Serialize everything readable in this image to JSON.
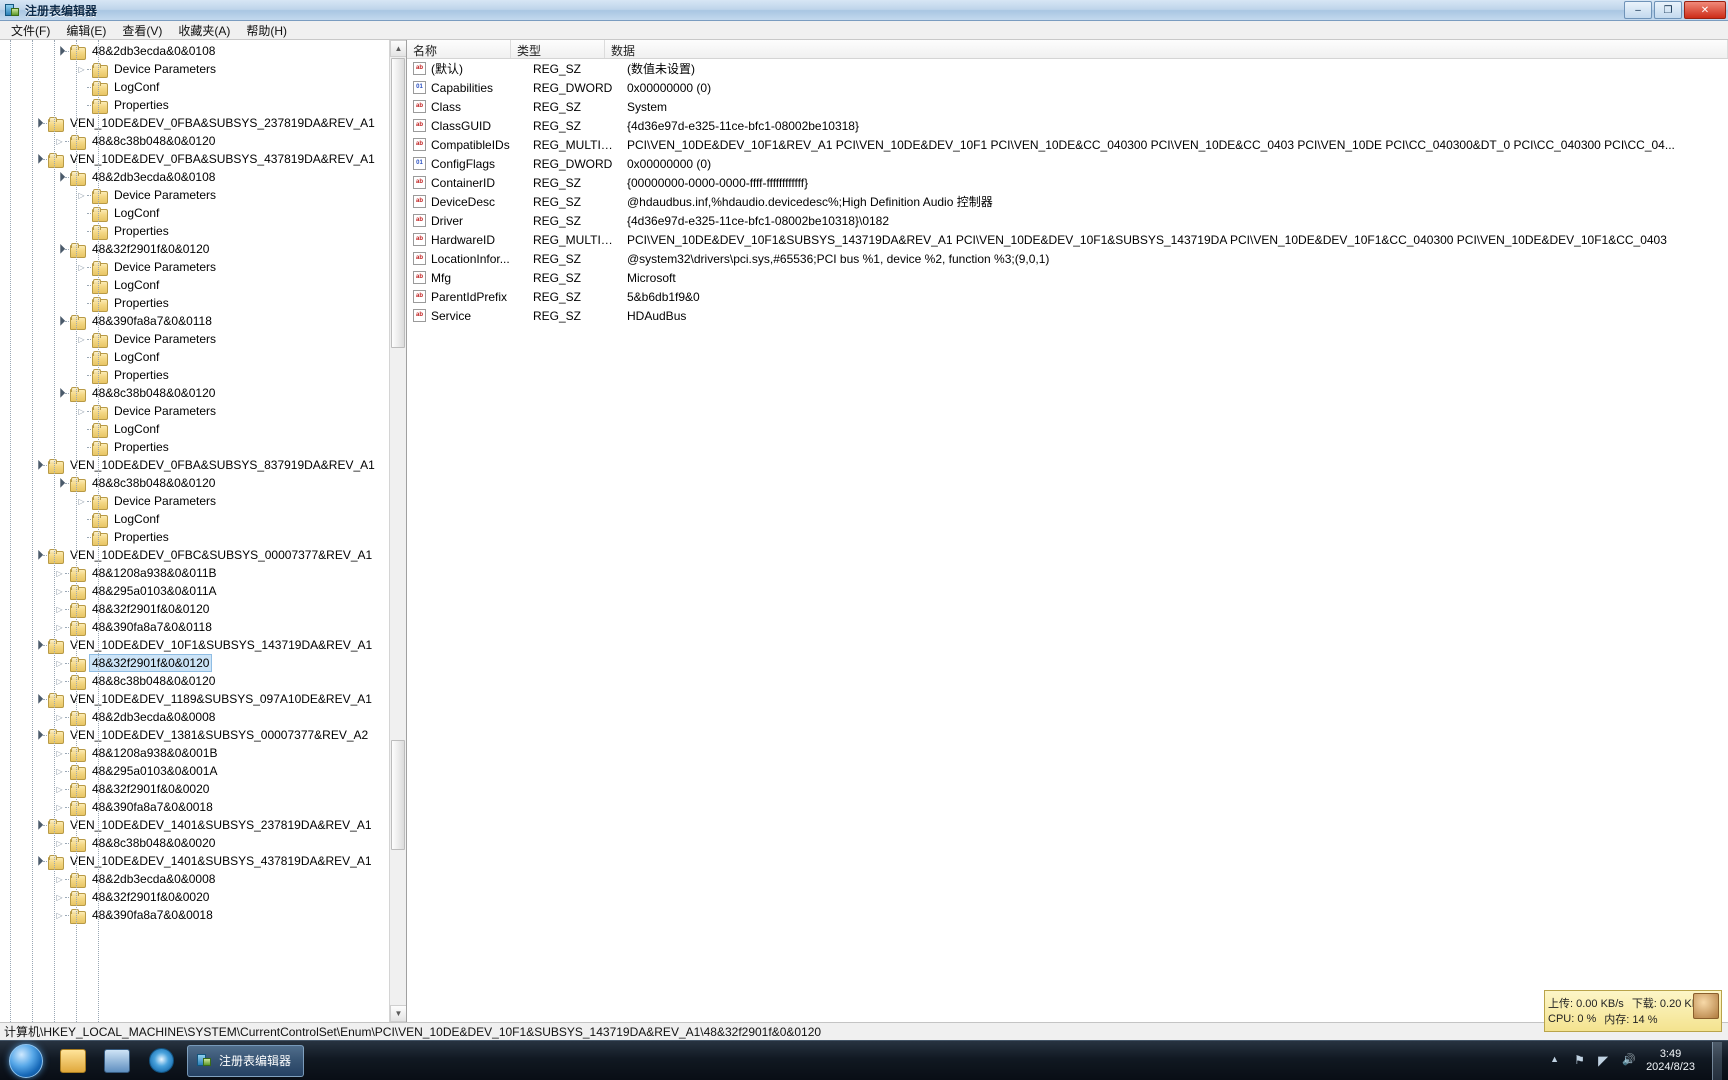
{
  "window": {
    "title": "注册表编辑器",
    "icon": "registry-icon",
    "buttons": {
      "minimize": "–",
      "maximize": "❐",
      "close": "✕"
    }
  },
  "menu": [
    {
      "label": "文件(F)"
    },
    {
      "label": "编辑(E)"
    },
    {
      "label": "查看(V)"
    },
    {
      "label": "收藏夹(A)"
    },
    {
      "label": "帮助(H)"
    }
  ],
  "tree": [
    {
      "label": "48&2db3ecda&0&0108",
      "depth": 3,
      "state": "open"
    },
    {
      "label": "Device Parameters",
      "depth": 4,
      "state": "closed"
    },
    {
      "label": "LogConf",
      "depth": 4,
      "state": "leaf"
    },
    {
      "label": "Properties",
      "depth": 4,
      "state": "leaf"
    },
    {
      "label": "VEN_10DE&DEV_0FBA&SUBSYS_237819DA&REV_A1",
      "depth": 2,
      "state": "open"
    },
    {
      "label": "48&8c38b048&0&0120",
      "depth": 3,
      "state": "closed"
    },
    {
      "label": "VEN_10DE&DEV_0FBA&SUBSYS_437819DA&REV_A1",
      "depth": 2,
      "state": "open"
    },
    {
      "label": "48&2db3ecda&0&0108",
      "depth": 3,
      "state": "open"
    },
    {
      "label": "Device Parameters",
      "depth": 4,
      "state": "closed"
    },
    {
      "label": "LogConf",
      "depth": 4,
      "state": "leaf"
    },
    {
      "label": "Properties",
      "depth": 4,
      "state": "leaf"
    },
    {
      "label": "48&32f2901f&0&0120",
      "depth": 3,
      "state": "open"
    },
    {
      "label": "Device Parameters",
      "depth": 4,
      "state": "closed"
    },
    {
      "label": "LogConf",
      "depth": 4,
      "state": "leaf"
    },
    {
      "label": "Properties",
      "depth": 4,
      "state": "leaf"
    },
    {
      "label": "48&390fa8a7&0&0118",
      "depth": 3,
      "state": "open"
    },
    {
      "label": "Device Parameters",
      "depth": 4,
      "state": "closed"
    },
    {
      "label": "LogConf",
      "depth": 4,
      "state": "leaf"
    },
    {
      "label": "Properties",
      "depth": 4,
      "state": "leaf"
    },
    {
      "label": "48&8c38b048&0&0120",
      "depth": 3,
      "state": "open"
    },
    {
      "label": "Device Parameters",
      "depth": 4,
      "state": "closed"
    },
    {
      "label": "LogConf",
      "depth": 4,
      "state": "leaf"
    },
    {
      "label": "Properties",
      "depth": 4,
      "state": "leaf"
    },
    {
      "label": "VEN_10DE&DEV_0FBA&SUBSYS_837919DA&REV_A1",
      "depth": 2,
      "state": "open"
    },
    {
      "label": "48&8c38b048&0&0120",
      "depth": 3,
      "state": "open"
    },
    {
      "label": "Device Parameters",
      "depth": 4,
      "state": "closed"
    },
    {
      "label": "LogConf",
      "depth": 4,
      "state": "leaf"
    },
    {
      "label": "Properties",
      "depth": 4,
      "state": "leaf"
    },
    {
      "label": "VEN_10DE&DEV_0FBC&SUBSYS_00007377&REV_A1",
      "depth": 2,
      "state": "open"
    },
    {
      "label": "48&1208a938&0&011B",
      "depth": 3,
      "state": "closed"
    },
    {
      "label": "48&295a0103&0&011A",
      "depth": 3,
      "state": "closed"
    },
    {
      "label": "48&32f2901f&0&0120",
      "depth": 3,
      "state": "closed"
    },
    {
      "label": "48&390fa8a7&0&0118",
      "depth": 3,
      "state": "closed"
    },
    {
      "label": "VEN_10DE&DEV_10F1&SUBSYS_143719DA&REV_A1",
      "depth": 2,
      "state": "open"
    },
    {
      "label": "48&32f2901f&0&0120",
      "depth": 3,
      "state": "closed",
      "selected": true
    },
    {
      "label": "48&8c38b048&0&0120",
      "depth": 3,
      "state": "closed"
    },
    {
      "label": "VEN_10DE&DEV_1189&SUBSYS_097A10DE&REV_A1",
      "depth": 2,
      "state": "open"
    },
    {
      "label": "48&2db3ecda&0&0008",
      "depth": 3,
      "state": "closed"
    },
    {
      "label": "VEN_10DE&DEV_1381&SUBSYS_00007377&REV_A2",
      "depth": 2,
      "state": "open"
    },
    {
      "label": "48&1208a938&0&001B",
      "depth": 3,
      "state": "closed"
    },
    {
      "label": "48&295a0103&0&001A",
      "depth": 3,
      "state": "closed"
    },
    {
      "label": "48&32f2901f&0&0020",
      "depth": 3,
      "state": "closed"
    },
    {
      "label": "48&390fa8a7&0&0018",
      "depth": 3,
      "state": "closed"
    },
    {
      "label": "VEN_10DE&DEV_1401&SUBSYS_237819DA&REV_A1",
      "depth": 2,
      "state": "open"
    },
    {
      "label": "48&8c38b048&0&0020",
      "depth": 3,
      "state": "closed"
    },
    {
      "label": "VEN_10DE&DEV_1401&SUBSYS_437819DA&REV_A1",
      "depth": 2,
      "state": "open"
    },
    {
      "label": "48&2db3ecda&0&0008",
      "depth": 3,
      "state": "closed"
    },
    {
      "label": "48&32f2901f&0&0020",
      "depth": 3,
      "state": "closed"
    },
    {
      "label": "48&390fa8a7&0&0018",
      "depth": 3,
      "state": "closed"
    }
  ],
  "list": {
    "columns": {
      "name": "名称",
      "type": "类型",
      "data": "数据"
    },
    "rows": [
      {
        "icon": "string-value-icon",
        "name": "(默认)",
        "type": "REG_SZ",
        "data": "(数值未设置)"
      },
      {
        "icon": "binary-value-icon",
        "name": "Capabilities",
        "type": "REG_DWORD",
        "data": "0x00000000 (0)"
      },
      {
        "icon": "string-value-icon",
        "name": "Class",
        "type": "REG_SZ",
        "data": "System"
      },
      {
        "icon": "string-value-icon",
        "name": "ClassGUID",
        "type": "REG_SZ",
        "data": "{4d36e97d-e325-11ce-bfc1-08002be10318}"
      },
      {
        "icon": "string-value-icon",
        "name": "CompatibleIDs",
        "type": "REG_MULTI_SZ",
        "data": "PCI\\VEN_10DE&DEV_10F1&REV_A1 PCI\\VEN_10DE&DEV_10F1 PCI\\VEN_10DE&CC_040300 PCI\\VEN_10DE&CC_0403 PCI\\VEN_10DE PCI\\CC_040300&DT_0 PCI\\CC_040300 PCI\\CC_04..."
      },
      {
        "icon": "binary-value-icon",
        "name": "ConfigFlags",
        "type": "REG_DWORD",
        "data": "0x00000000 (0)"
      },
      {
        "icon": "string-value-icon",
        "name": "ContainerID",
        "type": "REG_SZ",
        "data": "{00000000-0000-0000-ffff-ffffffffffff}"
      },
      {
        "icon": "string-value-icon",
        "name": "DeviceDesc",
        "type": "REG_SZ",
        "data": "@hdaudbus.inf,%hdaudio.devicedesc%;High Definition Audio 控制器"
      },
      {
        "icon": "string-value-icon",
        "name": "Driver",
        "type": "REG_SZ",
        "data": "{4d36e97d-e325-11ce-bfc1-08002be10318}\\0182"
      },
      {
        "icon": "string-value-icon",
        "name": "HardwareID",
        "type": "REG_MULTI_SZ",
        "data": "PCI\\VEN_10DE&DEV_10F1&SUBSYS_143719DA&REV_A1 PCI\\VEN_10DE&DEV_10F1&SUBSYS_143719DA PCI\\VEN_10DE&DEV_10F1&CC_040300 PCI\\VEN_10DE&DEV_10F1&CC_0403"
      },
      {
        "icon": "string-value-icon",
        "name": "LocationInfor...",
        "type": "REG_SZ",
        "data": "@system32\\drivers\\pci.sys,#65536;PCI bus %1, device %2, function %3;(9,0,1)"
      },
      {
        "icon": "string-value-icon",
        "name": "Mfg",
        "type": "REG_SZ",
        "data": "Microsoft"
      },
      {
        "icon": "string-value-icon",
        "name": "ParentIdPrefix",
        "type": "REG_SZ",
        "data": "5&b6db1f9&0"
      },
      {
        "icon": "string-value-icon",
        "name": "Service",
        "type": "REG_SZ",
        "data": "HDAudBus"
      }
    ]
  },
  "statusbar": {
    "path": "计算机\\HKEY_LOCAL_MACHINE\\SYSTEM\\CurrentControlSet\\Enum\\PCI\\VEN_10DE&DEV_10F1&SUBSYS_143719DA&REV_A1\\48&32f2901f&0&0120"
  },
  "gadget": {
    "upload": "上传: 0.00 KB/s",
    "download": "下载: 0.20 KB/s",
    "cpu": "CPU: 0 %",
    "memory": "内存: 14 %"
  },
  "taskbar": {
    "start": "start-orb",
    "pinned": [
      {
        "name": "explorer-icon"
      },
      {
        "name": "media-player-icon"
      },
      {
        "name": "browser-icon"
      }
    ],
    "active_task": "注册表编辑器",
    "clock_time": "3:49",
    "clock_date": "2024/8/23"
  }
}
